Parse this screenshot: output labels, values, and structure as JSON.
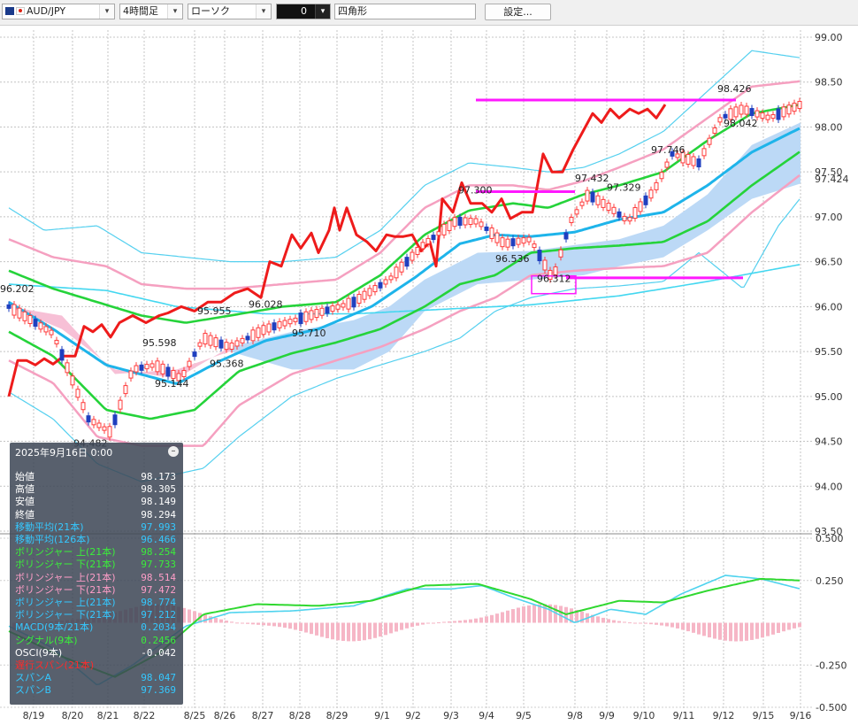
{
  "toolbar": {
    "symbol": "AUD/JPY",
    "timeframe": "4時間足",
    "chart_style": "ローソク",
    "line_width": "0",
    "drawing_tool": "四角形",
    "settings": "設定..."
  },
  "colors": {
    "bull": "#ff3b3b",
    "bear": "#1f3fbf",
    "ma21": "#1eb4ea",
    "ma126": "#43d7f0",
    "bb1": "#25d33a",
    "bb2": "#f5a0c0",
    "bb3": "#55d0ef",
    "chikou": "#ee1b1b",
    "hline": "#ff18ff",
    "kumo_bull": "#bcd9f6",
    "kumo_bear": "#f7c0d6",
    "macd": "#4fd3ee",
    "signal": "#30d830",
    "osci": "#f6b6c6"
  },
  "info_panel": {
    "datetime": "2025年9月16日 0:00",
    "rows": [
      {
        "label": "始値",
        "value": "98.173",
        "color": "#ffffff"
      },
      {
        "label": "高値",
        "value": "98.305",
        "color": "#ffffff"
      },
      {
        "label": "安値",
        "value": "98.149",
        "color": "#ffffff"
      },
      {
        "label": "終値",
        "value": "98.294",
        "color": "#ffffff"
      },
      {
        "label": "移動平均(21本)",
        "value": "97.993",
        "color": "#35c8ff"
      },
      {
        "label": "移動平均(126本)",
        "value": "96.466",
        "color": "#35c8ff"
      },
      {
        "label": "ボリンジャー 上(21本)",
        "value": "98.254",
        "color": "#3bee3b"
      },
      {
        "label": "ボリンジャー 下(21本)",
        "value": "97.733",
        "color": "#3bee3b"
      },
      {
        "label": "ボリンジャー 上(21本)",
        "value": "98.514",
        "color": "#ff9ec8"
      },
      {
        "label": "ボリンジャー 下(21本)",
        "value": "97.472",
        "color": "#ff9ec8"
      },
      {
        "label": "ボリンジャー 上(21本)",
        "value": "98.774",
        "color": "#35c8ff"
      },
      {
        "label": "ボリンジャー 下(21本)",
        "value": "97.212",
        "color": "#35c8ff"
      },
      {
        "label": "MACD(9本/21本)",
        "value": "0.2034",
        "color": "#35c8ff"
      },
      {
        "label": "シグナル(9本)",
        "value": "0.2456",
        "color": "#3bee3b"
      },
      {
        "label": "OSCI(9本)",
        "value": "-0.042",
        "color": "#ffffff"
      },
      {
        "label": "遅行スパン(21本)",
        "value": "",
        "color": "#ff2a2a"
      },
      {
        "label": "スパンA",
        "value": "98.047",
        "color": "#35c8ff"
      },
      {
        "label": "スパンB",
        "value": "97.369",
        "color": "#35c8ff"
      }
    ]
  },
  "chart_data": [
    {
      "type": "candlestick",
      "symbol": "AUD/JPY",
      "timeframe": "4時間足",
      "ylim": [
        93.5,
        99.0
      ],
      "y_ticks": [
        "99.00",
        "98.50",
        "98.00",
        "97.50",
        "97.00",
        "96.50",
        "96.00",
        "95.50",
        "95.00",
        "94.50",
        "94.00",
        "93.50"
      ],
      "current_price_label": "97.424",
      "x_ticks": [
        "8/19",
        "8/20",
        "8/21",
        "8/22",
        "8/25",
        "8/26",
        "8/27",
        "8/28",
        "8/29",
        "9/1",
        "9/2",
        "9/3",
        "9/4",
        "9/5",
        "9/8",
        "9/9",
        "9/10",
        "9/11",
        "9/12",
        "9/15",
        "9/16"
      ],
      "annotations": [
        {
          "text": "96.202",
          "x": "8/19",
          "y": 96.202
        },
        {
          "text": "95.598",
          "x": "8/22",
          "y": 95.598
        },
        {
          "text": "95.144",
          "x": "8/22",
          "y": 95.144
        },
        {
          "text": "94.482",
          "x": "8/21",
          "y": 94.482
        },
        {
          "text": "95.955",
          "x": "8/25",
          "y": 95.955
        },
        {
          "text": "95.368",
          "x": "8/25",
          "y": 95.368
        },
        {
          "text": "96.028",
          "x": "8/27",
          "y": 96.028
        },
        {
          "text": "95.710",
          "x": "8/28",
          "y": 95.71
        },
        {
          "text": "97.300",
          "x": "9/3",
          "y": 97.3
        },
        {
          "text": "96.536",
          "x": "9/4",
          "y": 96.536
        },
        {
          "text": "96.312",
          "x": "9/5",
          "y": 96.312
        },
        {
          "text": "97.432",
          "x": "9/8",
          "y": 97.432
        },
        {
          "text": "97.329",
          "x": "9/9",
          "y": 97.329
        },
        {
          "text": "97.746",
          "x": "9/10",
          "y": 97.746
        },
        {
          "text": "98.426",
          "x": "9/12",
          "y": 98.426
        },
        {
          "text": "98.042",
          "x": "9/12",
          "y": 98.042
        }
      ],
      "horizontal_lines": [
        98.3,
        97.28,
        96.32
      ],
      "rectangles": [
        {
          "label": "96.312",
          "x": "9/5",
          "y": 96.312
        }
      ],
      "series": [
        {
          "name": "移動平均(21本)",
          "last": 97.993
        },
        {
          "name": "移動平均(126本)",
          "last": 96.466
        },
        {
          "name": "ボリンジャー(21本) ±1σ",
          "upper_last": 98.254,
          "lower_last": 97.733
        },
        {
          "name": "ボリンジャー(21本) ±2σ",
          "upper_last": 98.514,
          "lower_last": 97.472
        },
        {
          "name": "ボリンジャー(21本) ±3σ",
          "upper_last": 98.774,
          "lower_last": 97.212
        },
        {
          "name": "スパンA",
          "last": 98.047
        },
        {
          "name": "スパンB",
          "last": 97.369
        }
      ]
    },
    {
      "type": "line",
      "panel": "MACD",
      "ylim": [
        -0.5,
        0.5
      ],
      "y_ticks": [
        "0.500",
        "0.250",
        "-0.250",
        "-0.500"
      ],
      "series": [
        {
          "name": "MACD(9本/21本)",
          "last": 0.2034
        },
        {
          "name": "シグナル(9本)",
          "last": 0.2456
        },
        {
          "name": "OSCI(9本)",
          "last": -0.042
        }
      ]
    }
  ]
}
